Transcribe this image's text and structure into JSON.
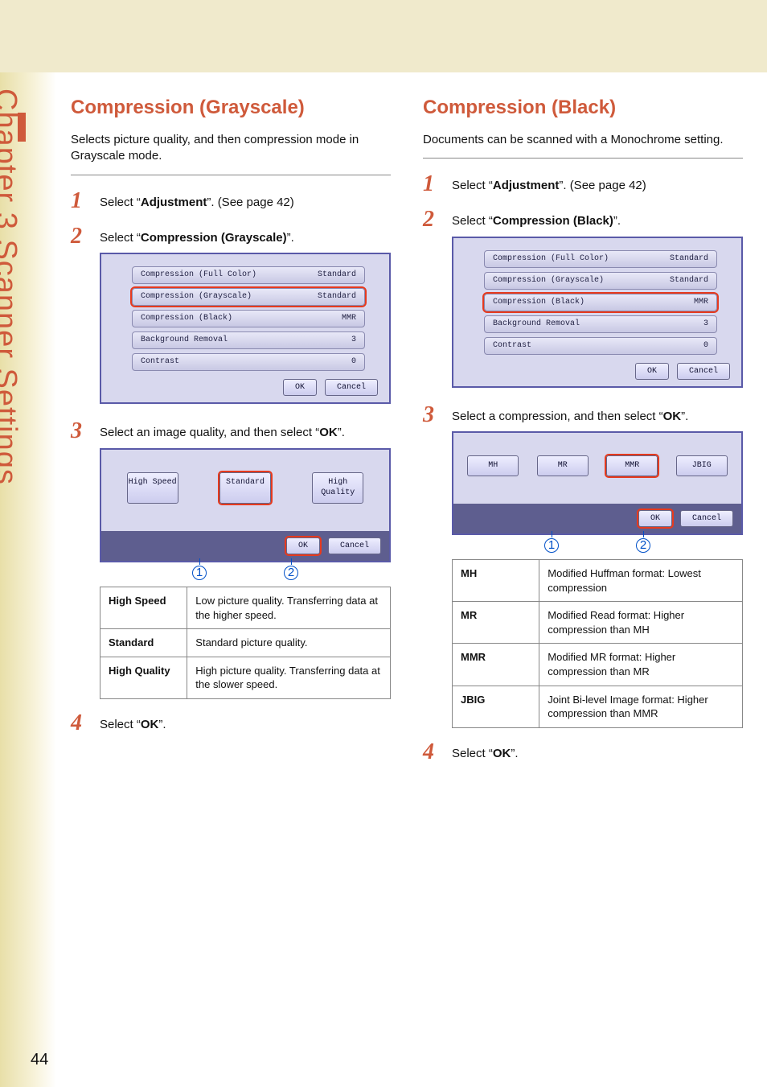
{
  "chapter_label": "Chapter 3    Scanner Settings",
  "page_number": "44",
  "left": {
    "heading": "Compression (Grayscale)",
    "intro": "Selects picture quality, and then compression mode in Grayscale mode.",
    "step1_pre": "Select “",
    "step1_bold": "Adjustment",
    "step1_post": "”. (See page 42)",
    "step2_pre": "Select “",
    "step2_bold": "Compression (Grayscale)",
    "step2_post": "”.",
    "panel_rows": [
      {
        "label": "Compression (Full Color)",
        "value": "Standard",
        "sel": false
      },
      {
        "label": "Compression (Grayscale)",
        "value": "Standard",
        "sel": true
      },
      {
        "label": "Compression (Black)",
        "value": "MMR",
        "sel": false
      },
      {
        "label": "Background Removal",
        "value": "3",
        "sel": false
      },
      {
        "label": "Contrast",
        "value": "0",
        "sel": false
      }
    ],
    "ok": "OK",
    "cancel": "Cancel",
    "step3_pre": "Select an image quality, and then select “",
    "step3_bold": "OK",
    "step3_post": "”.",
    "options": [
      {
        "label": "High Speed",
        "sel": false
      },
      {
        "label": "Standard",
        "sel": true
      },
      {
        "label": "High Quality",
        "sel": false
      }
    ],
    "callouts": [
      "1",
      "2"
    ],
    "table": [
      {
        "term": "High Speed",
        "desc": "Low picture quality. Transferring data at the higher speed."
      },
      {
        "term": "Standard",
        "desc": "Standard picture quality."
      },
      {
        "term": "High Quality",
        "desc": "High picture quality. Transferring data at the slower speed."
      }
    ],
    "step4_pre": "Select “",
    "step4_bold": "OK",
    "step4_post": "”."
  },
  "right": {
    "heading": "Compression (Black)",
    "intro": "Documents can be scanned with a Monochrome setting.",
    "step1_pre": "Select “",
    "step1_bold": "Adjustment",
    "step1_post": "”. (See page 42)",
    "step2_pre": "Select “",
    "step2_bold": "Compression (Black)",
    "step2_post": "”.",
    "panel_rows": [
      {
        "label": "Compression (Full Color)",
        "value": "Standard",
        "sel": false
      },
      {
        "label": "Compression (Grayscale)",
        "value": "Standard",
        "sel": false
      },
      {
        "label": "Compression (Black)",
        "value": "MMR",
        "sel": true
      },
      {
        "label": "Background Removal",
        "value": "3",
        "sel": false
      },
      {
        "label": "Contrast",
        "value": "0",
        "sel": false
      }
    ],
    "ok": "OK",
    "cancel": "Cancel",
    "step3_pre": "Select a compression, and then select “",
    "step3_bold": "OK",
    "step3_post": "”.",
    "options": [
      {
        "label": "MH",
        "sel": false
      },
      {
        "label": "MR",
        "sel": false
      },
      {
        "label": "MMR",
        "sel": true
      },
      {
        "label": "JBIG",
        "sel": false
      }
    ],
    "callouts": [
      "1",
      "2"
    ],
    "table": [
      {
        "term": "MH",
        "desc": "Modified Huffman format: Lowest compression"
      },
      {
        "term": "MR",
        "desc": "Modified Read format: Higher compression than MH"
      },
      {
        "term": "MMR",
        "desc": "Modified MR format: Higher compression than MR"
      },
      {
        "term": "JBIG",
        "desc": "Joint Bi-level Image format: Higher compression than MMR"
      }
    ],
    "step4_pre": "Select “",
    "step4_bold": "OK",
    "step4_post": "”."
  }
}
